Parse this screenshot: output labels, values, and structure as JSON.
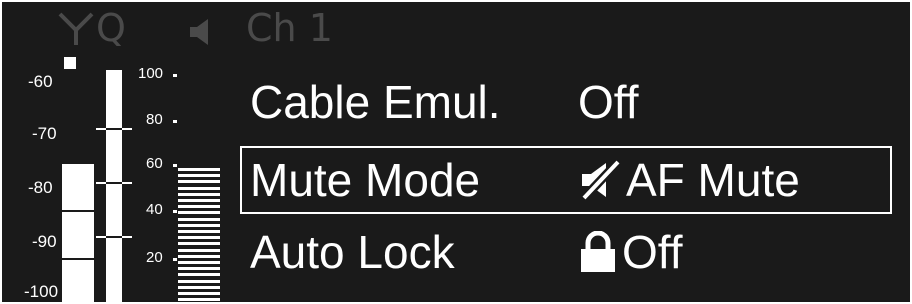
{
  "status_bar": {
    "antenna_icon": "antenna-icon",
    "quality_label": "Q",
    "speaker_icon": "speaker-icon",
    "channel": "Ch 1",
    "color": "#4a4a4a"
  },
  "rf_meter": {
    "scale_labels": [
      "-60",
      "-70",
      "-80",
      "-90",
      "-100"
    ],
    "level_db": -76,
    "peak_hold": true
  },
  "af_meter": {
    "scale_labels": [
      "100",
      "80",
      "60",
      "40",
      "20"
    ],
    "level_percent": 64
  },
  "menu": {
    "items": [
      {
        "label": "Cable Emul.",
        "value": "Off",
        "icon": ""
      },
      {
        "label": "Mute Mode",
        "value": "AF Mute",
        "icon": "muted-speaker-icon"
      },
      {
        "label": "Auto Lock",
        "value": "Off",
        "icon": "lock-icon"
      }
    ],
    "selected_index": 1
  },
  "colors": {
    "background": "#1a1a1a",
    "foreground": "#ffffff",
    "inactive": "#4a4a4a"
  }
}
